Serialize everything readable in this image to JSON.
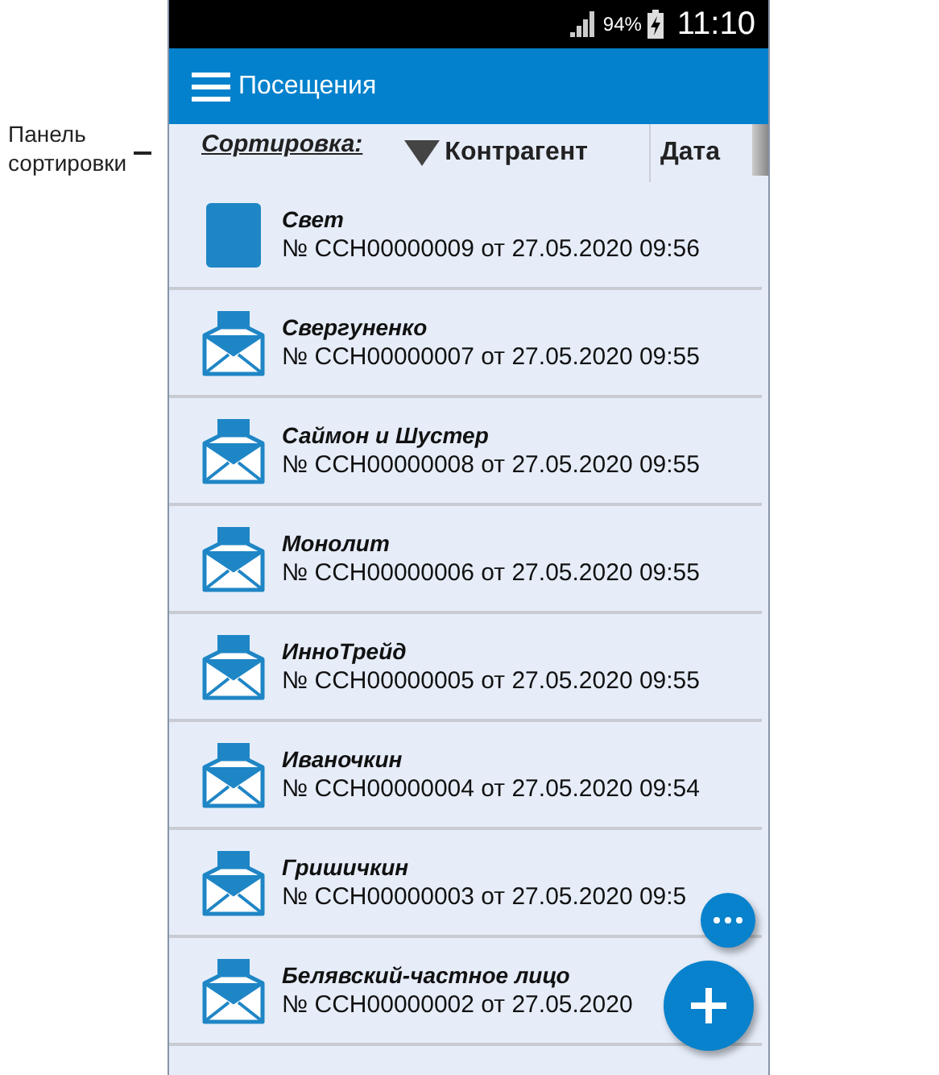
{
  "annotation": {
    "label": "Панель\nсортировки"
  },
  "status_bar": {
    "battery": "94%",
    "time": "11:10"
  },
  "app_bar": {
    "title": "Посещения"
  },
  "sort_bar": {
    "label": "Сортировка:",
    "options": [
      {
        "label": "Контрагент",
        "selected": true
      },
      {
        "label": "Дата",
        "selected": false
      }
    ]
  },
  "visits": [
    {
      "kind": "square",
      "name": "Свет",
      "detail": "№ ССН00000009 от 27.05.2020 09:56"
    },
    {
      "kind": "envelope",
      "name": "Свергуненко",
      "detail": "№ ССН00000007 от 27.05.2020 09:55"
    },
    {
      "kind": "envelope",
      "name": "Саймон и Шустер",
      "detail": "№ ССН00000008 от 27.05.2020 09:55"
    },
    {
      "kind": "envelope",
      "name": "Монолит",
      "detail": "№ ССН00000006 от 27.05.2020 09:55"
    },
    {
      "kind": "envelope",
      "name": "ИнноТрейд",
      "detail": "№ ССН00000005 от 27.05.2020 09:55"
    },
    {
      "kind": "envelope",
      "name": "Иваночкин",
      "detail": "№ ССН00000004 от 27.05.2020 09:54"
    },
    {
      "kind": "envelope",
      "name": "Гришичкин",
      "detail": "№ ССН00000003 от 27.05.2020 09:5"
    },
    {
      "kind": "envelope",
      "name": "Белявский-частное лицо",
      "detail": "№ ССН00000002 от 27.05.2020"
    }
  ]
}
